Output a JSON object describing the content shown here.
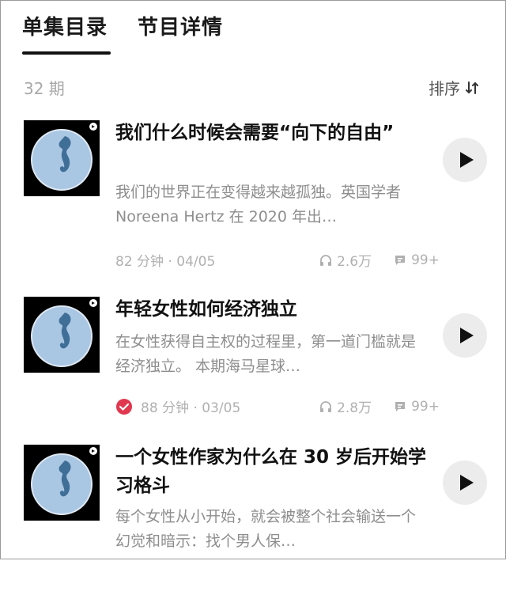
{
  "tabs": [
    {
      "label": "单集目录"
    },
    {
      "label": "节目详情"
    }
  ],
  "list": {
    "count": "32 期",
    "sort_label": "排序"
  },
  "episodes": [
    {
      "title": "我们什么时候会需要“向下的自由”",
      "desc": "我们的世界正在变得越来越孤独。英国学者 Noreena Hertz 在 2020 年出…",
      "duration": "82 分钟",
      "date": "04/05",
      "plays": "2.6万",
      "comments": "99+",
      "played": false
    },
    {
      "title": "年轻女性如何经济独立",
      "desc": "在女性获得自主权的过程里，第一道门槛就是经济独立。 本期海马星球…",
      "duration": "88 分钟",
      "date": "03/05",
      "plays": "2.8万",
      "comments": "99+",
      "played": true
    },
    {
      "title": "一个女性作家为什么在 30 岁后开始学习格斗",
      "desc": "每个女性从小开始，就会被整个社会输送一个幻觉和暗示：找个男人保…",
      "duration": "",
      "date": "",
      "plays": "",
      "comments": "",
      "played": false
    }
  ],
  "colors": {
    "check": "#e0384f",
    "cover_bg": "#000000",
    "cover_moon": "#9fc0e0"
  }
}
